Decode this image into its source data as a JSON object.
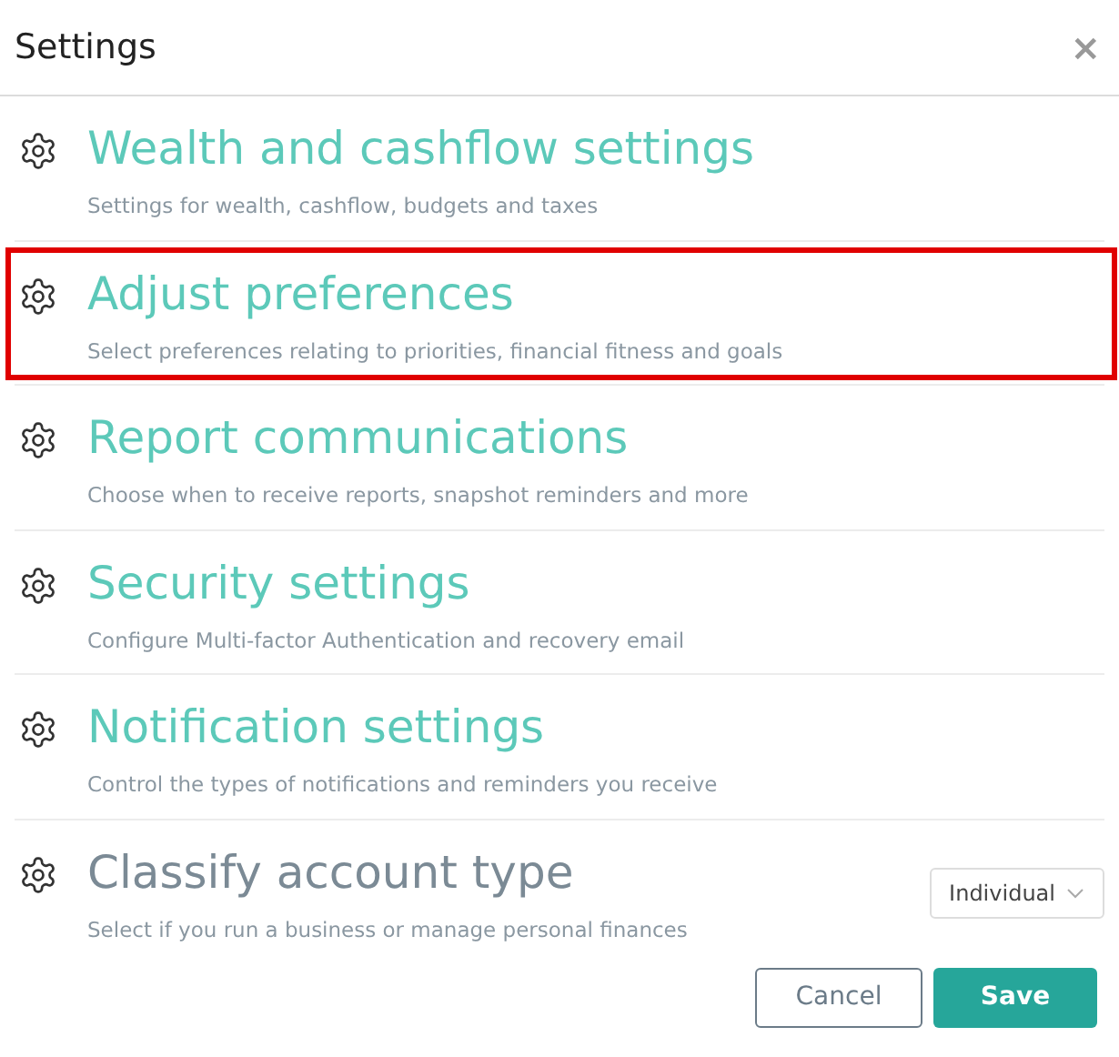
{
  "dialog": {
    "title": "Settings",
    "close": "×"
  },
  "items": [
    {
      "kind": "link",
      "title": "Wealth and cashflow settings",
      "description": "Settings for wealth, cashflow, budgets and taxes",
      "highlighted": false
    },
    {
      "kind": "link",
      "title": "Adjust preferences",
      "description": "Select preferences relating to priorities, financial fitness and goals",
      "highlighted": true
    },
    {
      "kind": "link",
      "title": "Report communications",
      "description": "Choose when to receive reports, snapshot reminders and more",
      "highlighted": false
    },
    {
      "kind": "link",
      "title": "Security settings",
      "description": "Configure Multi-factor Authentication and recovery email",
      "highlighted": false
    },
    {
      "kind": "link",
      "title": "Notification settings",
      "description": "Control the types of notifications and reminders you receive",
      "highlighted": false
    },
    {
      "kind": "select",
      "title": "Classify account type",
      "description": "Select if you run a business or manage personal finances",
      "highlighted": false,
      "value": "Individual"
    }
  ],
  "buttons": {
    "cancel": "Cancel",
    "save": "Save"
  }
}
